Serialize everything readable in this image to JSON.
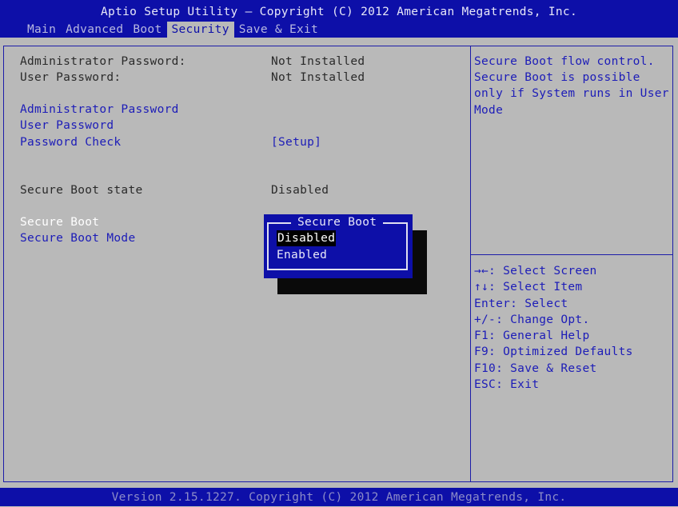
{
  "header": {
    "title": "Aptio Setup Utility – Copyright (C) 2012 American Megatrends, Inc.",
    "tabs": [
      "Main",
      "Advanced",
      "Boot",
      "Security",
      "Save & Exit"
    ],
    "active_tab": "Security"
  },
  "main": {
    "admin_password_label": "Administrator Password:",
    "admin_password_value": "Not Installed",
    "user_password_label": "User Password:",
    "user_password_value": "Not Installed",
    "set_admin_password": "Administrator Password",
    "set_user_password": "User Password",
    "password_check_label": "Password Check",
    "password_check_value": "[Setup]",
    "secure_boot_state_label": "Secure Boot state",
    "secure_boot_state_value": "Disabled",
    "secure_boot_label": "Secure Boot",
    "secure_boot_mode_label": "Secure Boot Mode"
  },
  "popup": {
    "title": "Secure Boot",
    "options": [
      "Disabled",
      "Enabled"
    ],
    "selected": "Disabled"
  },
  "help": {
    "lines": [
      "Secure Boot flow control.",
      "Secure Boot is possible",
      "only if System runs in User",
      "Mode"
    ]
  },
  "keys": [
    "→←: Select Screen",
    "↑↓: Select Item",
    "Enter: Select",
    "+/-: Change Opt.",
    "F1: General Help",
    "F9: Optimized Defaults",
    "F10: Save & Reset",
    "ESC: Exit"
  ],
  "footer": {
    "text": "Version 2.15.1227. Copyright (C) 2012 American Megatrends, Inc."
  },
  "colors": {
    "bios_blue": "#0d0fa8",
    "background_gray": "#b9b9b9",
    "link_blue": "#1c1cb8"
  }
}
